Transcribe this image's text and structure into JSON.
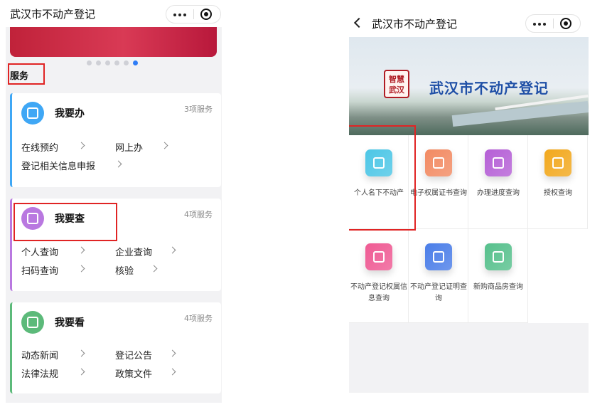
{
  "left_screen": {
    "title": "武汉市不动产登记",
    "section_label": "服务",
    "cards": [
      {
        "title": "我要办",
        "count": "3项服务",
        "color": "#3fa7f5",
        "icon": "edit-icon",
        "items": [
          {
            "label": "在线预约"
          },
          {
            "label": "网上办"
          },
          {
            "label": "登记相关信息申报"
          }
        ]
      },
      {
        "title": "我要查",
        "count": "4项服务",
        "color": "#b978e0",
        "icon": "document-search-icon",
        "items": [
          {
            "label": "个人查询"
          },
          {
            "label": "企业查询"
          },
          {
            "label": "扫码查询"
          },
          {
            "label": "核验"
          }
        ]
      },
      {
        "title": "我要看",
        "count": "4项服务",
        "color": "#5cba7a",
        "icon": "document-icon",
        "items": [
          {
            "label": "动态新闻"
          },
          {
            "label": "登记公告"
          },
          {
            "label": "法律法规"
          },
          {
            "label": "政策文件"
          }
        ]
      }
    ]
  },
  "right_screen": {
    "title": "武汉市不动产登记",
    "banner": {
      "seal_text": [
        "智慧",
        "武汉"
      ],
      "title": "武汉市不动产登记"
    },
    "services": [
      {
        "label": "个人名下不动产",
        "icon": "home-icon",
        "color": "#4cc6e6"
      },
      {
        "label": "电子权属证书查询",
        "icon": "certificate-icon",
        "color": "#f28a62"
      },
      {
        "label": "办理进度查询",
        "icon": "hourglass-icon",
        "color": "#b55fd6"
      },
      {
        "label": "授权查询",
        "icon": "shield-icon",
        "color": "#f2a81d"
      },
      {
        "label": "不动产登记权属信息查询",
        "icon": "search-document-icon",
        "color": "#ef5a93"
      },
      {
        "label": "不动产登记证明查询",
        "icon": "file-search-icon",
        "color": "#4a7de8"
      },
      {
        "label": "新购商品房查询",
        "icon": "building-icon",
        "color": "#56c08c"
      }
    ]
  }
}
